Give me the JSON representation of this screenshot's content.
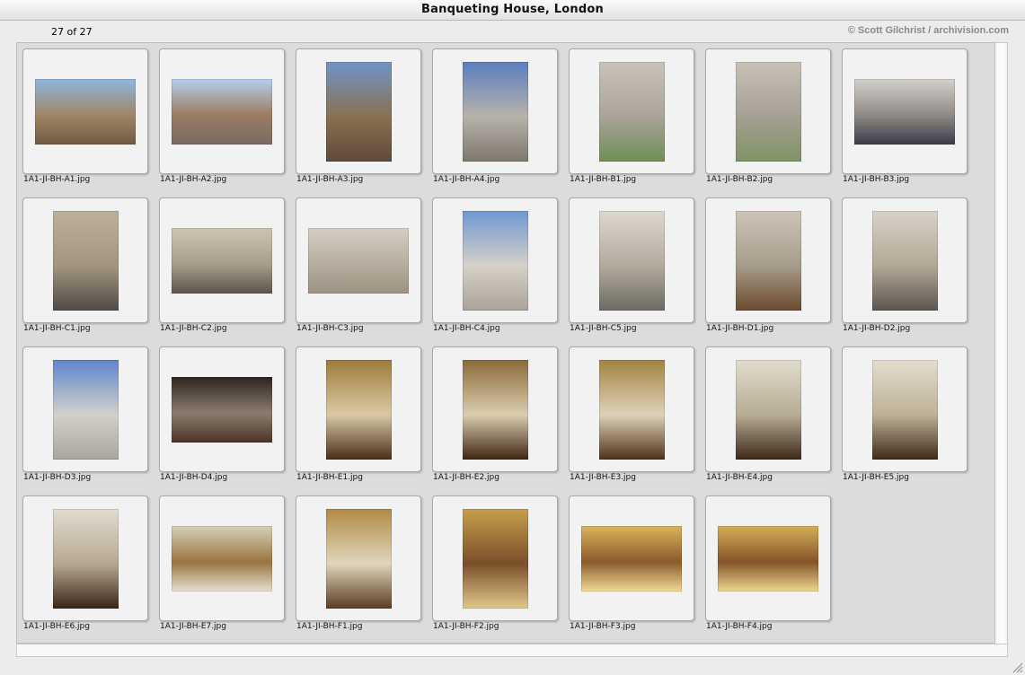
{
  "window": {
    "title": "Banqueting House, London"
  },
  "info": {
    "count": "27 of 27",
    "credit": "© Scott Gilchrist / archivision.com"
  },
  "thumbnails": [
    {
      "filename": "1A1-JI-BH-A1.jpg",
      "orientation": "landscape",
      "colors": [
        "#8fb6e0",
        "#a08666",
        "#6f5a44"
      ]
    },
    {
      "filename": "1A1-JI-BH-A2.jpg",
      "orientation": "landscape",
      "colors": [
        "#b5cfec",
        "#9a7d62",
        "#7a6a62"
      ]
    },
    {
      "filename": "1A1-JI-BH-A3.jpg",
      "orientation": "portrait",
      "colors": [
        "#6f95c8",
        "#8a7052",
        "#5e4b3a"
      ]
    },
    {
      "filename": "1A1-JI-BH-A4.jpg",
      "orientation": "portrait",
      "colors": [
        "#5a7fc0",
        "#b7b2aa",
        "#7d776e"
      ]
    },
    {
      "filename": "1A1-JI-BH-B1.jpg",
      "orientation": "portrait",
      "colors": [
        "#c9c4ba",
        "#a9a39a",
        "#6f8f56"
      ]
    },
    {
      "filename": "1A1-JI-BH-B2.jpg",
      "orientation": "portrait",
      "colors": [
        "#c7c1b6",
        "#a59f95",
        "#7e9463"
      ]
    },
    {
      "filename": "1A1-JI-BH-B3.jpg",
      "orientation": "landscape",
      "colors": [
        "#d4d0cb",
        "#8f8a86",
        "#3b3c48"
      ]
    },
    {
      "filename": "1A1-JI-BH-C1.jpg",
      "orientation": "portrait",
      "colors": [
        "#bdb19c",
        "#a39680",
        "#4f4a44"
      ]
    },
    {
      "filename": "1A1-JI-BH-C2.jpg",
      "orientation": "landscape",
      "colors": [
        "#cdc4b2",
        "#a79d8a",
        "#5a554e"
      ]
    },
    {
      "filename": "1A1-JI-BH-C3.jpg",
      "orientation": "landscape",
      "colors": [
        "#d5cfc4",
        "#b6ad9e",
        "#9c9282"
      ]
    },
    {
      "filename": "1A1-JI-BH-C4.jpg",
      "orientation": "portrait",
      "colors": [
        "#6f97d2",
        "#d6d1c8",
        "#a9a399"
      ]
    },
    {
      "filename": "1A1-JI-BH-C5.jpg",
      "orientation": "portrait",
      "colors": [
        "#ddd8cf",
        "#b2aa9d",
        "#6d6a62"
      ]
    },
    {
      "filename": "1A1-JI-BH-D1.jpg",
      "orientation": "portrait",
      "colors": [
        "#cdc5b7",
        "#a69c8b",
        "#6b4a2e"
      ]
    },
    {
      "filename": "1A1-JI-BH-D2.jpg",
      "orientation": "portrait",
      "colors": [
        "#d8d3c9",
        "#b2a895",
        "#5b564f"
      ]
    },
    {
      "filename": "1A1-JI-BH-D3.jpg",
      "orientation": "portrait",
      "colors": [
        "#5d86cf",
        "#d3d0ca",
        "#a9a6a0"
      ]
    },
    {
      "filename": "1A1-JI-BH-D4.jpg",
      "orientation": "landscape",
      "colors": [
        "#2c2420",
        "#8b7d6e",
        "#4a3426"
      ]
    },
    {
      "filename": "1A1-JI-BH-E1.jpg",
      "orientation": "portrait",
      "colors": [
        "#a07a3a",
        "#d8c9a5",
        "#4a2d18"
      ]
    },
    {
      "filename": "1A1-JI-BH-E2.jpg",
      "orientation": "portrait",
      "colors": [
        "#8c6a38",
        "#d9cdb0",
        "#402612"
      ]
    },
    {
      "filename": "1A1-JI-BH-E3.jpg",
      "orientation": "portrait",
      "colors": [
        "#a4823e",
        "#ddd2b8",
        "#4f311a"
      ]
    },
    {
      "filename": "1A1-JI-BH-E4.jpg",
      "orientation": "portrait",
      "colors": [
        "#e1dccd",
        "#b8ad95",
        "#3c2818"
      ]
    },
    {
      "filename": "1A1-JI-BH-E5.jpg",
      "orientation": "portrait",
      "colors": [
        "#e3ddce",
        "#bdb198",
        "#3f2a18"
      ]
    },
    {
      "filename": "1A1-JI-BH-E6.jpg",
      "orientation": "portrait",
      "colors": [
        "#e2dccf",
        "#b6a992",
        "#3a2517"
      ]
    },
    {
      "filename": "1A1-JI-BH-E7.jpg",
      "orientation": "landscape",
      "colors": [
        "#d6cfb8",
        "#9a7440",
        "#e6e0d0"
      ]
    },
    {
      "filename": "1A1-JI-BH-F1.jpg",
      "orientation": "portrait",
      "colors": [
        "#b08a44",
        "#e0d6bc",
        "#5a3b20"
      ]
    },
    {
      "filename": "1A1-JI-BH-F2.jpg",
      "orientation": "portrait",
      "colors": [
        "#c79e4c",
        "#7a4f2a",
        "#e0c98c"
      ]
    },
    {
      "filename": "1A1-JI-BH-F3.jpg",
      "orientation": "landscape",
      "colors": [
        "#d9b45c",
        "#8c5a2c",
        "#f0dc94"
      ]
    },
    {
      "filename": "1A1-JI-BH-F4.jpg",
      "orientation": "landscape",
      "colors": [
        "#d4ae58",
        "#855428",
        "#eed790"
      ]
    }
  ]
}
